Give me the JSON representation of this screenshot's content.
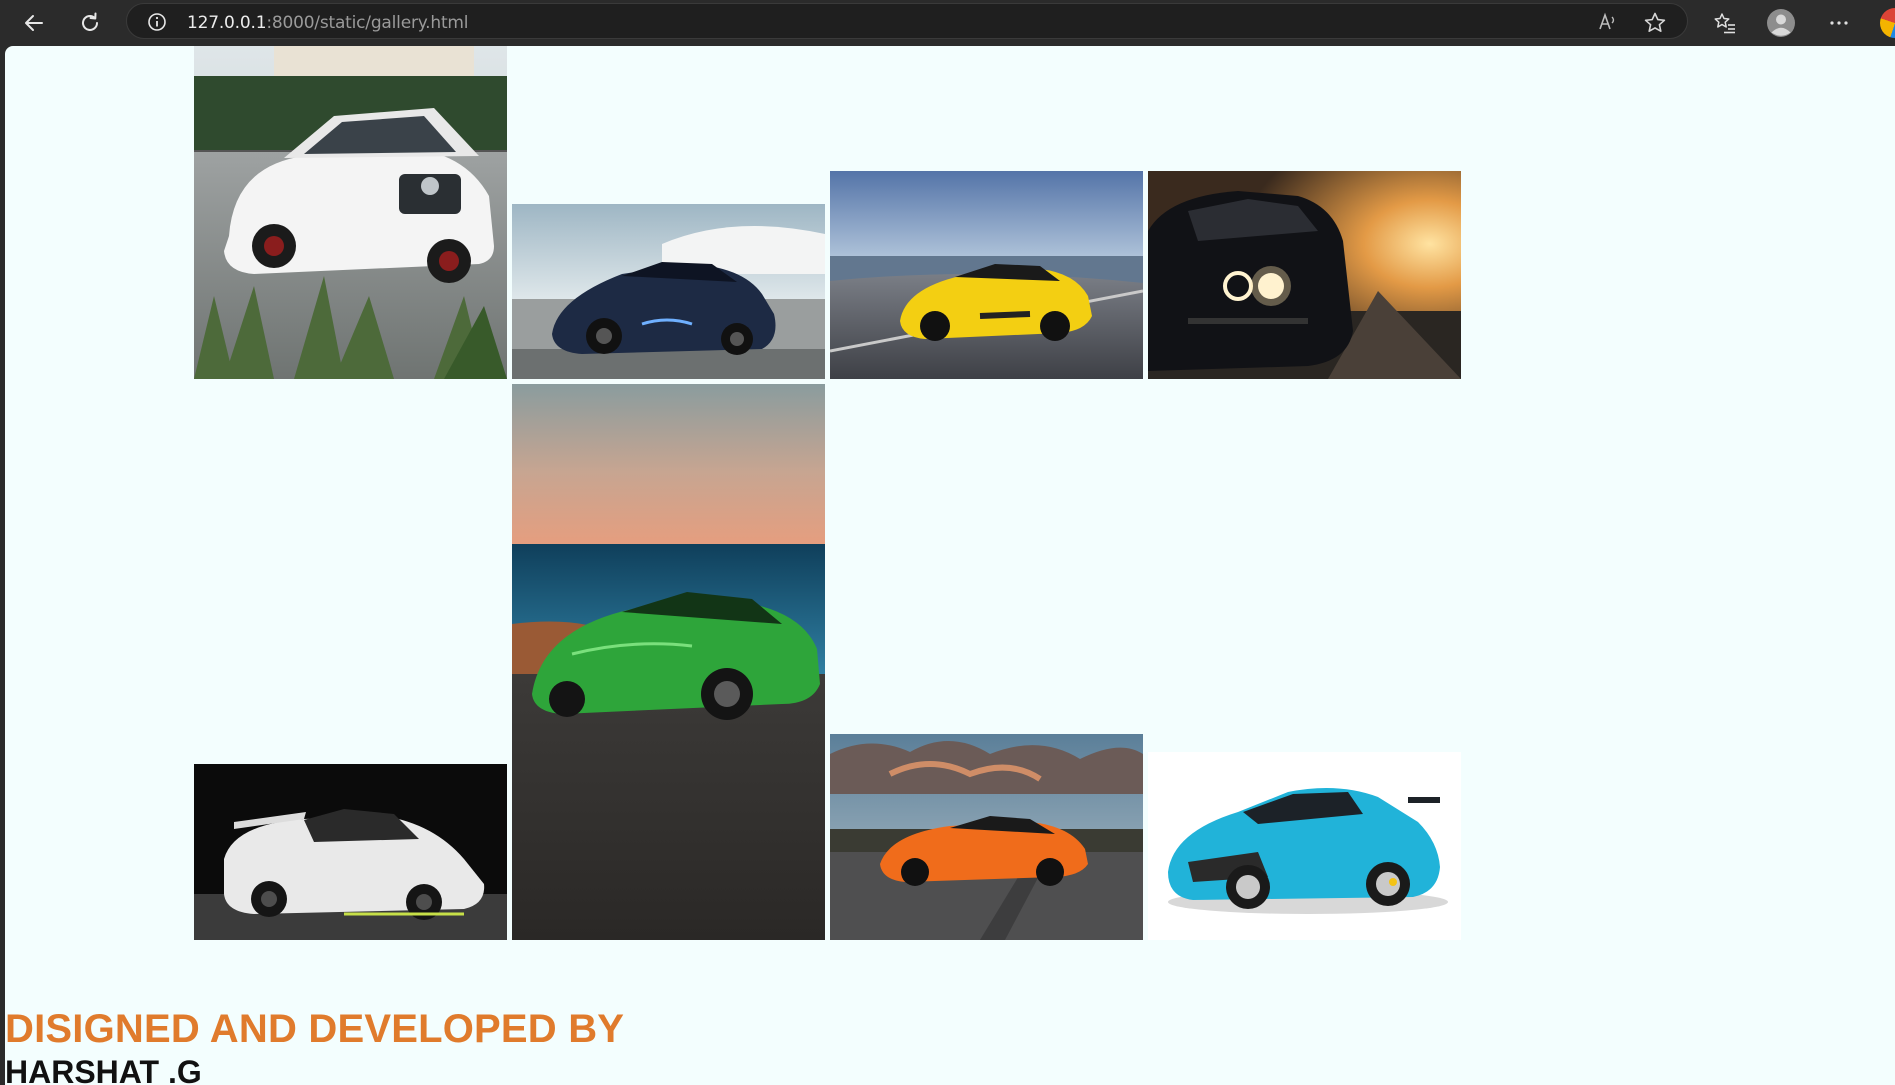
{
  "browser": {
    "url_host": "127.0.0.1",
    "url_rest": ":8000/static/gallery.html",
    "icons": [
      "back-arrow-icon",
      "refresh-icon",
      "site-info-icon",
      "read-aloud-icon",
      "favorite-star-icon",
      "favorites-list-icon",
      "profile-icon",
      "more-menu-icon",
      "edge-logo-icon"
    ]
  },
  "gallery": {
    "photos": [
      {
        "name": "white-mercedes-suv-photo",
        "subject": "white SUV on cobblestone driveway"
      },
      {
        "name": "dark-blue-lamborghini-photo",
        "subject": "dark blue supercar by the sea"
      },
      {
        "name": "yellow-corvette-photo",
        "subject": "yellow sports car on curved road"
      },
      {
        "name": "dark-muscle-car-sunset-photo",
        "subject": "dark muscle car with glowing headlights at sunset"
      },
      {
        "name": "green-lamborghini-photo",
        "subject": "green supercar by the ocean"
      },
      {
        "name": "white-koenigsegg-photo",
        "subject": "white hypercar on black background"
      },
      {
        "name": "orange-corvette-photo",
        "subject": "orange sports car under dramatic sky"
      },
      {
        "name": "blue-porsche-gt2-photo",
        "subject": "light blue porsche on white background"
      }
    ]
  },
  "footer": {
    "credit_line": "DISIGNED AND DEVELOPED BY",
    "author": "HARSHAT .G",
    "credit_color": "#e07b2c"
  },
  "colors": {
    "page_background": "#f3fefe",
    "chrome_background": "#2b2b2b"
  }
}
